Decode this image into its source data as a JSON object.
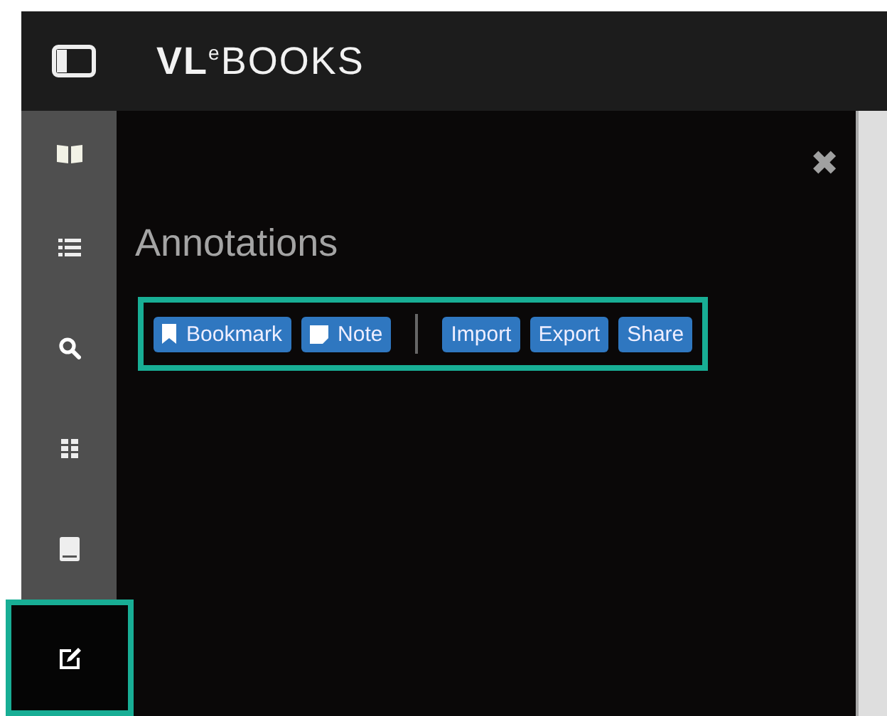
{
  "header": {
    "logo": "**VL**$^{e}$BOOKS"
  },
  "sidebar": {
    "items": [
      {
        "kind": "book",
        "selected": false,
        "highlighted": false
      },
      {
        "kind": "list",
        "selected": false,
        "highlighted": false
      },
      {
        "kind": "search",
        "selected": false,
        "highlighted": false
      },
      {
        "kind": "grid",
        "selected": false,
        "highlighted": false
      },
      {
        "kind": "notebook",
        "selected": false,
        "highlighted": false
      },
      {
        "kind": "edit",
        "selected": true,
        "highlighted": true
      }
    ]
  },
  "panel": {
    "title": "Annotations",
    "close": "✖",
    "toolbar": {
      "highlighted": true,
      "groups": [
        [
          {
            "kind": "bookmark",
            "label": "Bookmark"
          },
          {
            "kind": "note",
            "label": "Note"
          }
        ],
        [
          {
            "kind": "plain",
            "label": "Import"
          },
          {
            "kind": "plain",
            "label": "Export"
          },
          {
            "kind": "plain",
            "label": "Share"
          }
        ]
      ]
    }
  }
}
